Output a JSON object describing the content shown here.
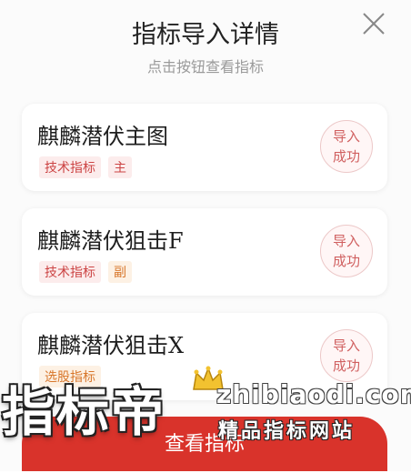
{
  "dialog": {
    "title": "指标导入详情",
    "subtitle": "点击按钮查看指标",
    "close_icon": "close-icon"
  },
  "items": [
    {
      "name": "麒麟潜伏主图",
      "tags": [
        "技术指标",
        "主"
      ],
      "status_line1": "导入",
      "status_line2": "成功"
    },
    {
      "name": "麒麟潜伏狙击F",
      "tags": [
        "技术指标",
        "副"
      ],
      "status_line1": "导入",
      "status_line2": "成功"
    },
    {
      "name": "麒麟潜伏狙击X",
      "tags": [
        "选股指标"
      ],
      "status_line1": "导入",
      "status_line2": "成功"
    }
  ],
  "footer": {
    "button_label": "查看指标"
  },
  "watermark": {
    "brand": "指标帝",
    "url": "zhibiaodi.com",
    "slogan": "精品指标网站",
    "crown_icon": "crown-icon"
  },
  "colors": {
    "accent_red": "#d9332b",
    "tag_red": "#c44444",
    "tag_orange": "#d8772c",
    "crown_gold": "#f2c230"
  }
}
